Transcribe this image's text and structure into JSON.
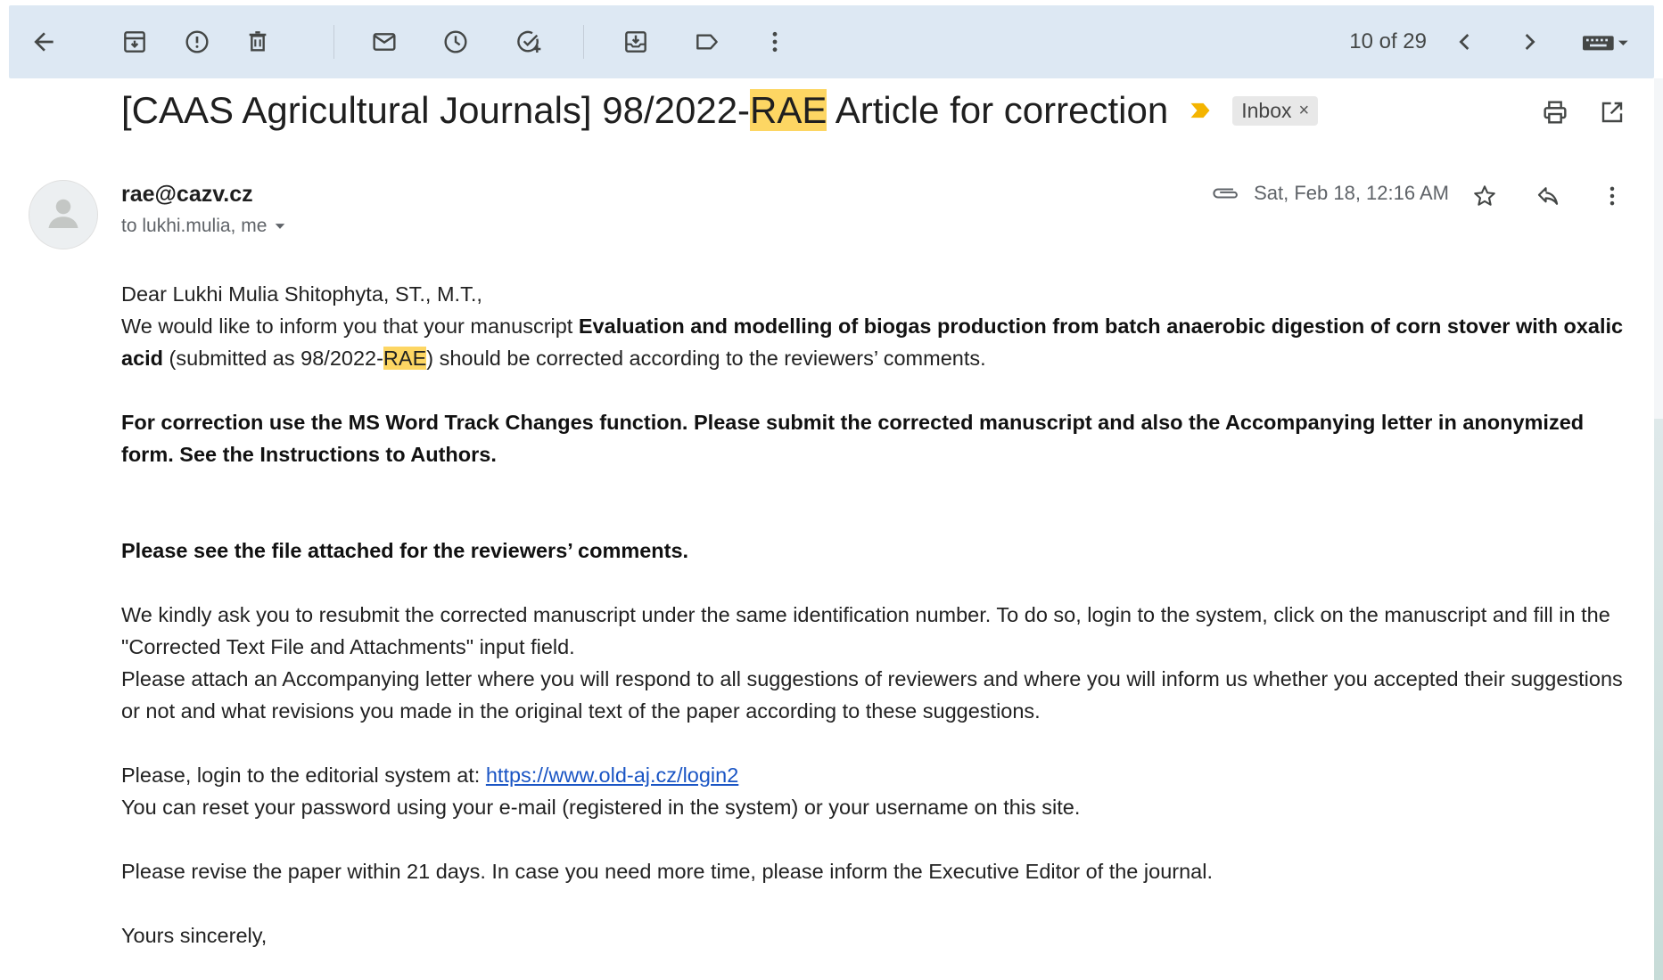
{
  "toolbar": {
    "counter": "10 of 29",
    "icons": [
      "back-arrow-icon",
      "archive-icon",
      "report-spam-icon",
      "delete-icon",
      "mark-unread-icon",
      "snooze-icon",
      "add-to-tasks-icon",
      "move-to-icon",
      "label-icon",
      "more-vert-icon",
      "newer-icon",
      "older-icon",
      "input-tools-icon"
    ]
  },
  "subject": {
    "prefix": "[CAAS Agricultural Journals] 98/2022-",
    "highlight": "RAE",
    "suffix": " Article for correction",
    "label": "Inbox",
    "label_close": "×"
  },
  "message": {
    "sender": "rae@cazv.cz",
    "recipients": "to lukhi.mulia, me",
    "date": "Sat, Feb 18, 12:16 AM"
  },
  "body": {
    "greeting": "Dear Lukhi Mulia Shitophyta, ST., M.T.,",
    "p1_a": "We would like to inform you that your manuscript ",
    "p1_title": "Evaluation and modelling of biogas production from batch anaerobic digestion of corn stover with oxalic acid",
    "p1_b": " (submitted as 98/2022-",
    "p1_hl": "RAE",
    "p1_c": ") should be corrected according to the reviewers’ comments.",
    "p2": "For correction use the MS Word Track Changes function. Please submit the corrected manuscript and also the Accompanying letter in anonymized form. See the Instructions to Authors.",
    "p3": "Please see the file attached for the reviewers’ comments.",
    "p4": "We kindly ask you to resubmit the corrected manuscript under the same identification number. To do so, login to the system, click on the manuscript and fill in the \"Corrected Text File and Attachments\" input field.",
    "p5": "Please attach an Accompanying letter where you will respond to all suggestions of reviewers and where you will inform us whether you accepted their suggestions or not and what revisions you made in the original text of the paper according to these suggestions.",
    "p6_a": "Please, login to the editorial system at: ",
    "p6_link": "https://www.old-aj.cz/login2",
    "p7": "You can reset your password using your e-mail (registered in the system) or your username on this site.",
    "p8": "Please revise the paper within 21 days. In case you need more time, please inform the Executive Editor of the journal.",
    "p9": "Yours sincerely,"
  },
  "colors": {
    "toolbar_bg": "#dde8f3",
    "highlight": "#fdd663",
    "link": "#1a55c4",
    "importance": "#f4b400"
  }
}
